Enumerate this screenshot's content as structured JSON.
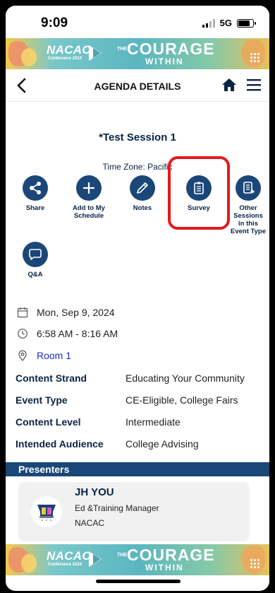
{
  "status": {
    "time": "9:09",
    "network": "5G"
  },
  "banner": {
    "org": "NACAC",
    "conference": "Conference 2024",
    "the": "THE",
    "courage": "COURAGE",
    "within": "WITHIN"
  },
  "header": {
    "title": "AGENDA DETAILS"
  },
  "session": {
    "title": "*Test Session 1",
    "timezone": "Time Zone: Pacific"
  },
  "actions": [
    {
      "label": "Share",
      "icon": "share-icon"
    },
    {
      "label": "Add to My Schedule",
      "icon": "plus-icon"
    },
    {
      "label": "Notes",
      "icon": "pencil-icon"
    },
    {
      "label": "Survey",
      "icon": "clipboard-icon"
    },
    {
      "label": "Other Sessions in this Event Type",
      "icon": "document-list-icon"
    },
    {
      "label": "Q&A",
      "icon": "chat-bubble-icon"
    }
  ],
  "info": {
    "date": "Mon, Sep 9, 2024",
    "time": "6:58 AM - 8:16 AM",
    "room": "Room 1"
  },
  "details": [
    {
      "key": "Content Strand",
      "value": "Educating Your Community"
    },
    {
      "key": "Event Type",
      "value": "CE-Eligible, College Fairs"
    },
    {
      "key": "Content Level",
      "value": "Intermediate"
    },
    {
      "key": "Intended Audience",
      "value": "College Advising"
    }
  ],
  "presenters": {
    "heading": "Presenters",
    "items": [
      {
        "name": "JH YOU",
        "role": "Ed &Training Manager",
        "org": "NACAC"
      }
    ]
  },
  "colors": {
    "navy": "#1b4778",
    "highlight": "#e31a1c",
    "link": "#1d2cc4"
  }
}
